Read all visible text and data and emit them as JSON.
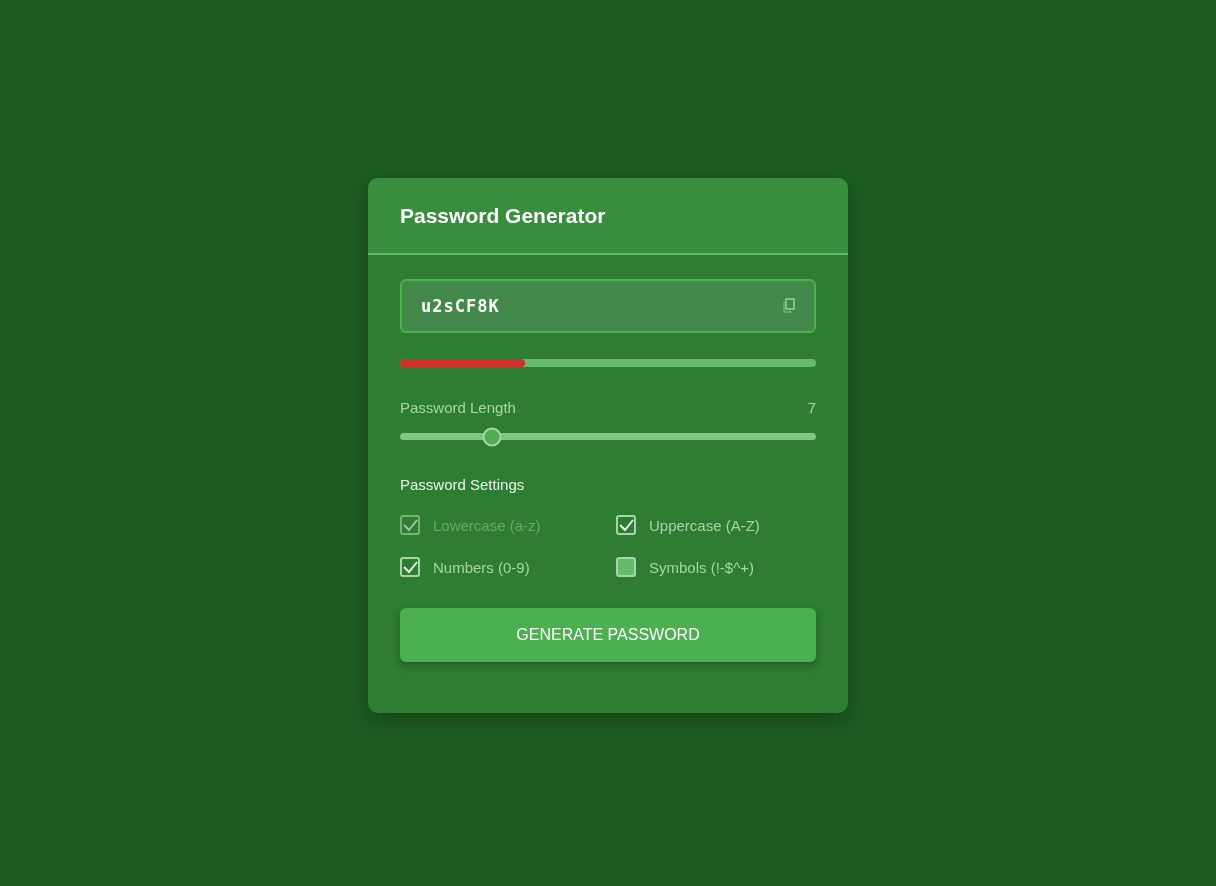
{
  "card": {
    "title": "Password Generator"
  },
  "password": {
    "value": "u2sCF8K"
  },
  "strength": {
    "level": 0.3
  },
  "length": {
    "label": "Password Length",
    "value": "7",
    "level": 0.22
  },
  "settings": {
    "title": "Password Settings",
    "options": [
      {
        "label": "Lowercase (a-z)",
        "checked": true,
        "disabled": true
      },
      {
        "label": "Uppercase (A-Z)",
        "checked": true,
        "disabled": false
      },
      {
        "label": "Numbers (0-9)",
        "checked": true,
        "disabled": false
      },
      {
        "label": "Symbols (!-$^+)",
        "checked": false,
        "disabled": false
      }
    ]
  },
  "button": {
    "label": "GENERATE PASSWORD"
  }
}
